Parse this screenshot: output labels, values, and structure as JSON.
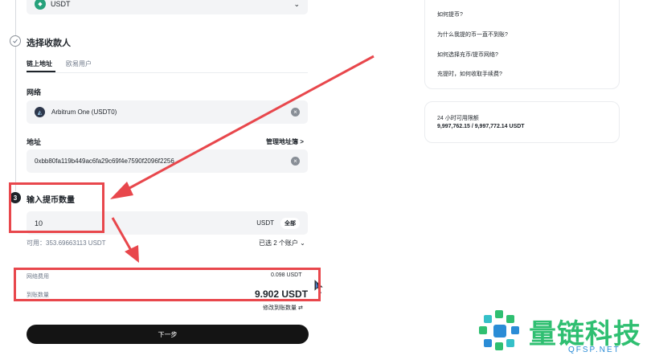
{
  "coin": {
    "value": "USDT"
  },
  "steps": {
    "recipient_title": "选择收款人",
    "amount_title": "输入提币数量",
    "amount_step_number": "3"
  },
  "recipient_tabs": [
    "链上地址",
    "欧易用户"
  ],
  "network": {
    "label": "网络",
    "value": "Arbitrum One (USDT0)"
  },
  "address": {
    "label": "地址",
    "manage_link": "管理地址簿 >",
    "value": "0xbb80fa119b449ac6fa29c69f4e7590f2096f‌‌2256"
  },
  "amount": {
    "value": "10",
    "unit": "USDT",
    "all_button": "全部",
    "available": "可用：353.69663113 USDT",
    "accounts_selector": "已选 2 个账户"
  },
  "fees": {
    "fee_label": "网络费用",
    "fee_value": "0.098 USDT",
    "receive_label": "到账数量",
    "receive_value": "9.902 USDT",
    "edit_receive": "修改到账数量"
  },
  "next_button": "下一步",
  "faq": {
    "items": [
      "如何提币?",
      "为什么我提的币一直不到账?",
      "如何选择充币/提币网络?",
      "充提时，如何收取手续费?"
    ]
  },
  "limit": {
    "title": "24 小时可用限额",
    "value": "9,997,762.15 / 9,997,772.14 USDT"
  },
  "watermark": {
    "name": "量链科技",
    "domain": "QFSP.NET"
  },
  "colors": {
    "annotation_red": "#e8474c",
    "watermark_green": "#2fbf71",
    "watermark_blue": "#2a8cd6"
  }
}
